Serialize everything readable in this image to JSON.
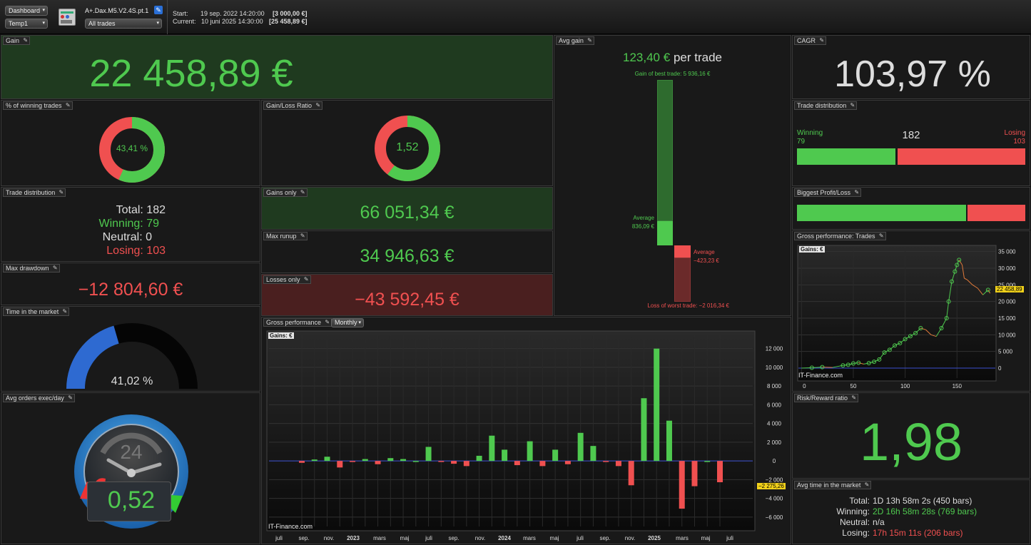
{
  "toolbar": {
    "dashboard_select": "Dashboard",
    "template_select": "Temp1",
    "strategy_name": "A+.Dax.M5.V2.4S.pt.1",
    "trades_filter": "All trades",
    "start_label": "Start:",
    "start_date": "19 sep. 2022 14:20:00",
    "start_value": "[3 000,00 €]",
    "current_label": "Current:",
    "current_date": "10 juni 2025 14:30:00",
    "current_value": "[25 458,89 €]"
  },
  "gain": {
    "title": "Gain",
    "value": "22 458,89 €"
  },
  "winning_pct": {
    "title": "% of winning trades",
    "value": "43,41 %",
    "fraction": 0.4341
  },
  "gain_loss_ratio": {
    "title": "Gain/Loss Ratio",
    "value": "1,52",
    "fraction": 0.603
  },
  "trade_dist_text": {
    "title": "Trade distribution",
    "total": "Total: 182",
    "winning": "Winning: 79",
    "neutral": "Neutral: 0",
    "losing": "Losing: 103"
  },
  "gains_only": {
    "title": "Gains only",
    "value": "66 051,34 €"
  },
  "max_runup": {
    "title": "Max runup",
    "value": "34 946,63 €"
  },
  "losses_only": {
    "title": "Losses only",
    "value": "−43 592,45 €"
  },
  "max_drawdown": {
    "title": "Max drawdown",
    "value": "−12 804,60 €"
  },
  "time_in_market": {
    "title": "Time in the market",
    "value": "41,02 %",
    "fraction": 0.4102
  },
  "avg_orders": {
    "title": "Avg orders exec/day",
    "value": "0,52",
    "dial_label": "24"
  },
  "avg_gain": {
    "title": "Avg gain",
    "value": "123,40 €",
    "suffix": "per trade",
    "best": "Gain of best trade: 5 936,16 €",
    "avg_win_label": "Average",
    "avg_win_value": "836,09 €",
    "avg_loss_label": "Average",
    "avg_loss_value": "−423,23 €",
    "worst": "Loss of worst trade: −2 016,34 €"
  },
  "cagr": {
    "title": "CAGR",
    "value": "103,97 %"
  },
  "trade_dist_bar": {
    "title": "Trade distribution",
    "winning_label": "Winning",
    "winning_count": "79",
    "total": "182",
    "losing_label": "Losing",
    "losing_count": "103",
    "win_fraction": 0.434
  },
  "biggest_pl": {
    "title": "Biggest Profit/Loss",
    "profit_fraction": 0.746
  },
  "gross_trades": {
    "title": "Gross performance: Trades",
    "legend": "Gains: €",
    "watermark": "IT-Finance.com",
    "last_value": "22 458,89",
    "y_ticks": [
      "35 000",
      "30 000",
      "25 000",
      "20 000",
      "15 000",
      "10 000",
      "5 000",
      "0"
    ],
    "x_ticks": [
      "0",
      "50",
      "100",
      "150"
    ]
  },
  "risk_reward": {
    "title": "Risk/Reward ratio",
    "value": "1,98"
  },
  "avg_time": {
    "title": "Avg time in the market",
    "total_label": "Total:",
    "total_value": "1D 13h 58m 2s (450 bars)",
    "winning_label": "Winning:",
    "winning_value": "2D 16h 58m 28s (769 bars)",
    "neutral_label": "Neutral:",
    "neutral_value": "n/a",
    "losing_label": "Losing:",
    "losing_value": "17h 15m 11s (206 bars)"
  },
  "gross_monthly": {
    "title": "Gross performance",
    "period_select": "Monthly",
    "legend": "Gains: €",
    "watermark": "IT-Finance.com",
    "last_value": "−2 275,26",
    "y_ticks": [
      "12 000",
      "10 000",
      "8 000",
      "6 000",
      "4 000",
      "2 000",
      "0",
      "−2 000",
      "−4 000",
      "−6 000"
    ],
    "x_ticks": [
      "juli",
      "sep.",
      "nov.",
      "2023",
      "mars",
      "maj",
      "juli",
      "sep.",
      "nov.",
      "2024",
      "mars",
      "maj",
      "juli",
      "sep.",
      "nov.",
      "2025",
      "mars",
      "maj",
      "juli"
    ]
  },
  "chart_data": [
    {
      "type": "bar",
      "title": "Gross performance",
      "legend": "Gains: €",
      "categories": [
        "sep.2022",
        "okt.2022",
        "nov.2022",
        "dec.2022",
        "jan.2023",
        "feb.2023",
        "mars.2023",
        "apr.2023",
        "maj.2023",
        "juni.2023",
        "juli.2023",
        "aug.2023",
        "sep.2023",
        "okt.2023",
        "nov.2023",
        "dec.2023",
        "jan.2024",
        "feb.2024",
        "mars.2024",
        "apr.2024",
        "maj.2024",
        "juni.2024",
        "juli.2024",
        "aug.2024",
        "sep.2024",
        "okt.2024",
        "nov.2024",
        "dec.2024",
        "jan.2025",
        "feb.2025",
        "mars.2025",
        "apr.2025",
        "maj.2025",
        "juni.2025"
      ],
      "values": [
        -200,
        150,
        450,
        -700,
        -100,
        200,
        -350,
        300,
        200,
        0,
        1500,
        -100,
        -300,
        -550,
        550,
        2700,
        1200,
        -450,
        2100,
        -550,
        1200,
        -350,
        3000,
        1600,
        -100,
        -550,
        -2600,
        6700,
        12000,
        4300,
        -5100,
        -2700,
        0,
        -2275.26
      ],
      "ylim": [
        -6000,
        12000
      ],
      "colors": {
        "positive": "#4fc94f",
        "negative": "#f05050"
      }
    },
    {
      "type": "line",
      "title": "Gross performance: Trades",
      "legend": "Gains: €",
      "x": [
        0,
        10,
        20,
        30,
        40,
        45,
        50,
        55,
        60,
        65,
        70,
        75,
        80,
        85,
        90,
        95,
        100,
        105,
        110,
        115,
        120,
        125,
        130,
        135,
        140,
        142,
        145,
        148,
        150,
        152,
        155,
        157,
        160,
        165,
        170,
        175,
        180,
        182
      ],
      "y": [
        0,
        100,
        300,
        200,
        800,
        1000,
        1400,
        1600,
        1200,
        1500,
        1900,
        2600,
        4700,
        5500,
        6800,
        7500,
        8700,
        9600,
        10500,
        12000,
        11500,
        10000,
        9500,
        12000,
        15000,
        20000,
        26000,
        29000,
        31000,
        32500,
        31000,
        27000,
        26500,
        25000,
        24000,
        22000,
        23500,
        22459
      ],
      "ylim": [
        -3000,
        36000
      ],
      "xlim": [
        -3,
        187
      ]
    }
  ]
}
